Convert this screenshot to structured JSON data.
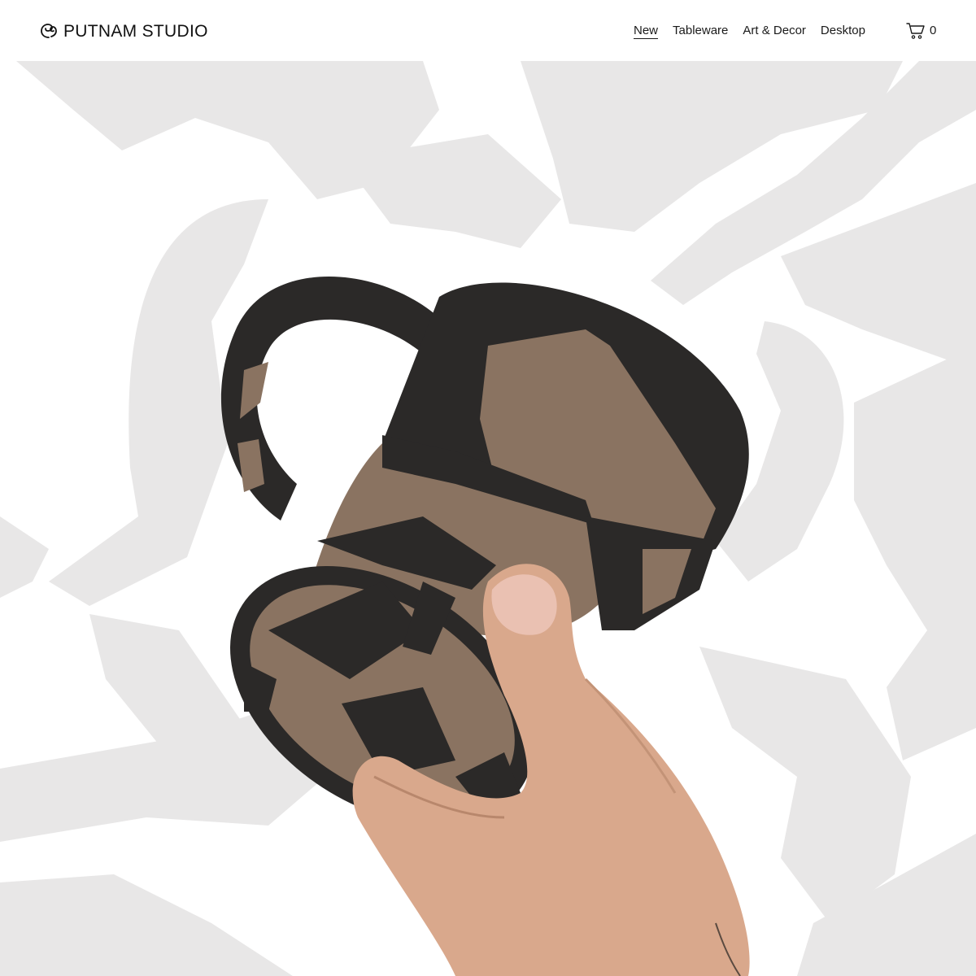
{
  "brand": {
    "name": "PUTNAM STUDIO",
    "logo_icon": "ee-monogram-icon"
  },
  "nav": {
    "items": [
      {
        "label": "New",
        "active": true
      },
      {
        "label": "Tableware",
        "active": false
      },
      {
        "label": "Art & Decor",
        "active": false
      },
      {
        "label": "Desktop",
        "active": false
      }
    ]
  },
  "cart": {
    "icon": "cart-icon",
    "count": "0"
  },
  "hero": {
    "image": "hand-holding-ceramic-pitcher-photo"
  },
  "colors": {
    "text": "#1a1a1a",
    "background": "#ffffff",
    "backdrop_gray": "#e9e8e8",
    "glaze_black": "#2b2928",
    "clay_brown": "#8a7361",
    "skin": "#d9a88c"
  }
}
